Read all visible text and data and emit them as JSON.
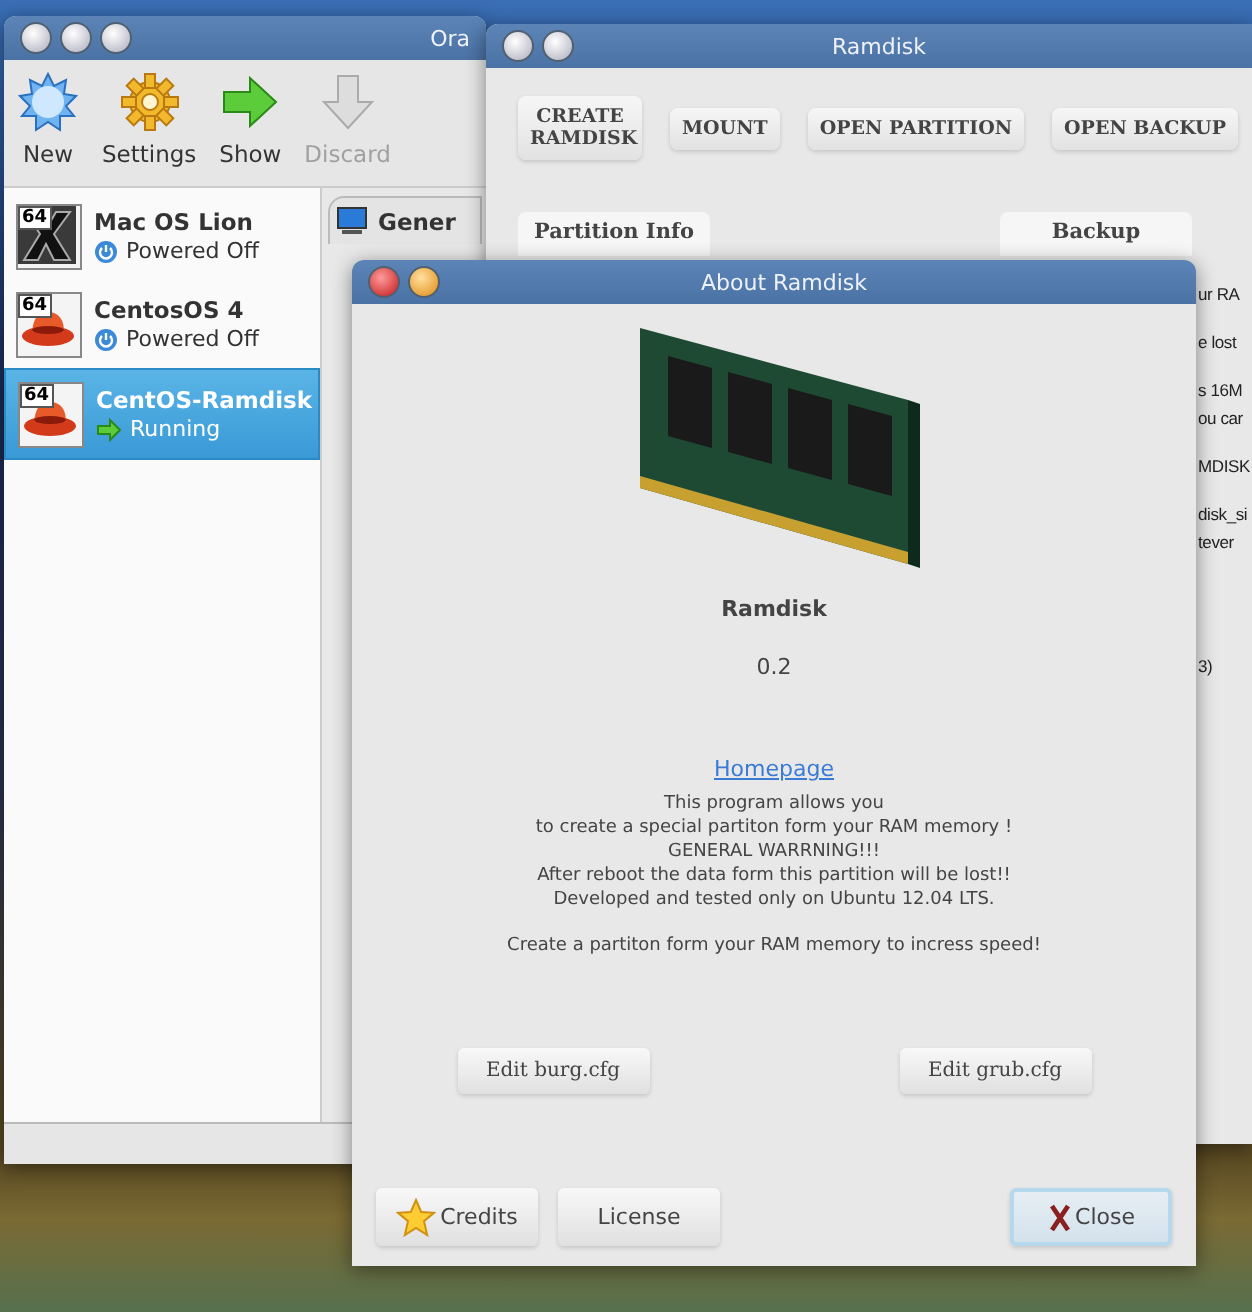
{
  "virtualbox_window": {
    "title": "Ora",
    "toolbar": [
      {
        "label": "New",
        "kind": "new",
        "disabled": false
      },
      {
        "label": "Settings",
        "kind": "settings",
        "disabled": false
      },
      {
        "label": "Show",
        "kind": "show",
        "disabled": false
      },
      {
        "label": "Discard",
        "kind": "discard",
        "disabled": true
      }
    ],
    "vms": [
      {
        "name": "Mac OS Lion",
        "badge": "64",
        "kind": "mac",
        "status": {
          "label": "Powered Off",
          "kind": "off"
        },
        "selected": false
      },
      {
        "name": "CentosOS 4",
        "badge": "64",
        "kind": "redhat",
        "status": {
          "label": "Powered Off",
          "kind": "off"
        },
        "selected": false
      },
      {
        "name": "CentOS-Ramdisk",
        "badge": "64",
        "kind": "redhat",
        "status": {
          "label": "Running",
          "kind": "running"
        },
        "selected": true
      }
    ],
    "details_tab": "Gener"
  },
  "ramdisk_window": {
    "title": "Ramdisk",
    "buttons": [
      "CREATE RAMDISK",
      "MOUNT",
      "OPEN PARTITION",
      "OPEN BACKUP"
    ],
    "sections": [
      "Partition Info",
      "Backup"
    ],
    "cut_lines": [
      "ur RA",
      "e lost",
      "s 16M",
      "ou car",
      "MDISK",
      "disk_si",
      "tever",
      "3)"
    ]
  },
  "about_dialog": {
    "title": "About Ramdisk",
    "app_name": "Ramdisk",
    "version": "0.2",
    "link": "Homepage",
    "description": [
      "This program allows you",
      "to create a special partiton form your RAM memory !",
      "GENERAL WARRNING!!!",
      "After reboot the data form this partition will be lost!!",
      "Developed and tested only on Ubuntu 12.04 LTS."
    ],
    "tagline": "Create a partiton form your RAM memory to incress speed!",
    "edit_buttons": [
      "Edit burg.cfg",
      "Edit grub.cfg"
    ],
    "buttons": [
      {
        "label": "Credits",
        "kind": "credits"
      },
      {
        "label": "License",
        "kind": "license"
      },
      {
        "label": "Close",
        "kind": "close"
      }
    ]
  }
}
